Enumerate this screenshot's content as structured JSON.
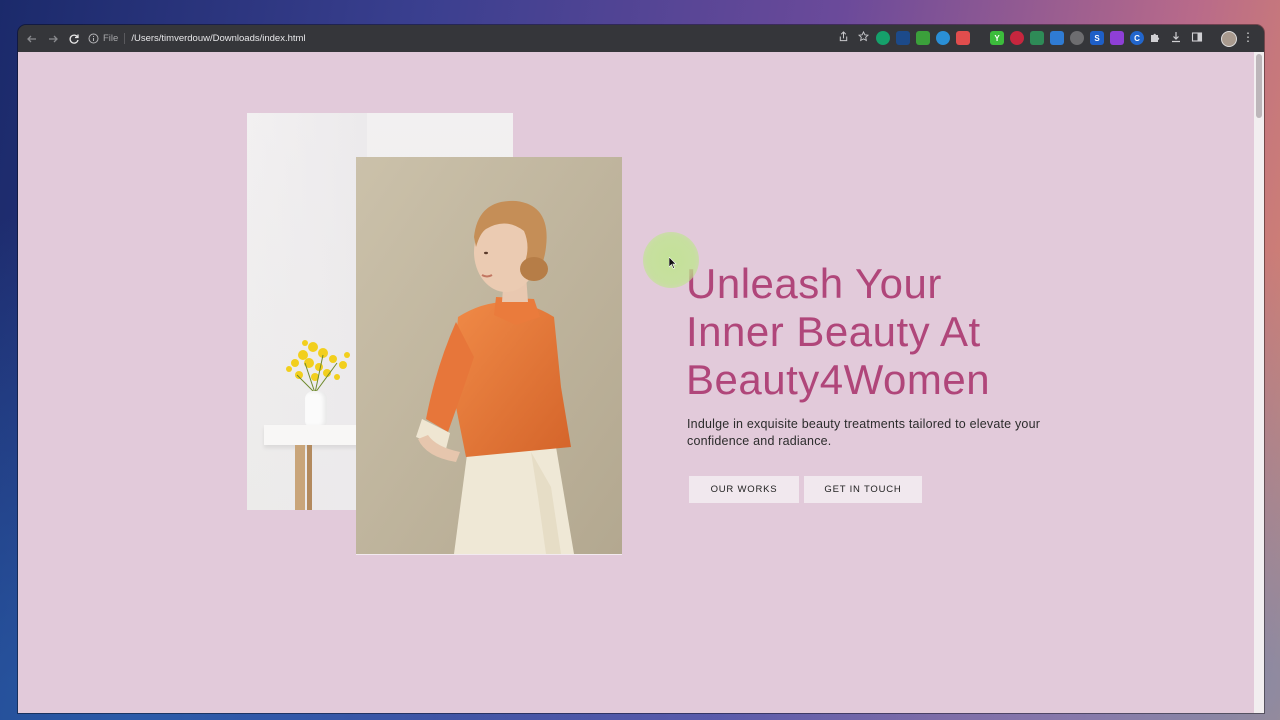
{
  "browser": {
    "url_prefix": "File",
    "url": "/Users/timverdouw/Downloads/index.html",
    "extensions": [
      {
        "icon": "grammarly-icon",
        "color": "#15a06b",
        "label": ""
      },
      {
        "icon": "extension-blue-icon",
        "color": "#1c4a8a",
        "label": ""
      },
      {
        "icon": "table-icon",
        "color": "#3ba03b",
        "label": ""
      },
      {
        "icon": "gem-icon",
        "color": "#2a8fd6",
        "label": ""
      },
      {
        "icon": "color-wheel-icon",
        "color": "#e04d4d",
        "label": ""
      },
      {
        "icon": "yellow-ext-icon",
        "color": "#3cbc3c",
        "label": "Y"
      },
      {
        "icon": "red-ext-icon",
        "color": "#c7263e",
        "label": ""
      },
      {
        "icon": "globe-icon",
        "color": "#2e8b57",
        "label": ""
      },
      {
        "icon": "download-arrow-icon",
        "color": "#2f7bd3",
        "label": ""
      },
      {
        "icon": "grey-ext-icon",
        "color": "#6d6d70",
        "label": ""
      },
      {
        "icon": "s-ext-icon",
        "color": "#1e5fc7",
        "label": "S"
      },
      {
        "icon": "purple-ext-icon",
        "color": "#8e3fd6",
        "label": ""
      },
      {
        "icon": "c-ext-icon",
        "color": "#2266cc",
        "label": "C"
      }
    ]
  },
  "hero": {
    "title_lines": [
      "Unleash Your",
      "Inner Beauty At",
      "Beauty4Women"
    ],
    "subtitle": "Indulge in exquisite beauty treatments tailored to elevate your confidence and radiance.",
    "buttons": {
      "works": "OUR WORKS",
      "touch": "GET IN TOUCH"
    }
  },
  "colors": {
    "page_background": "#e2cada",
    "title": "#b0467a",
    "button_bg": "#f1e8ee"
  }
}
